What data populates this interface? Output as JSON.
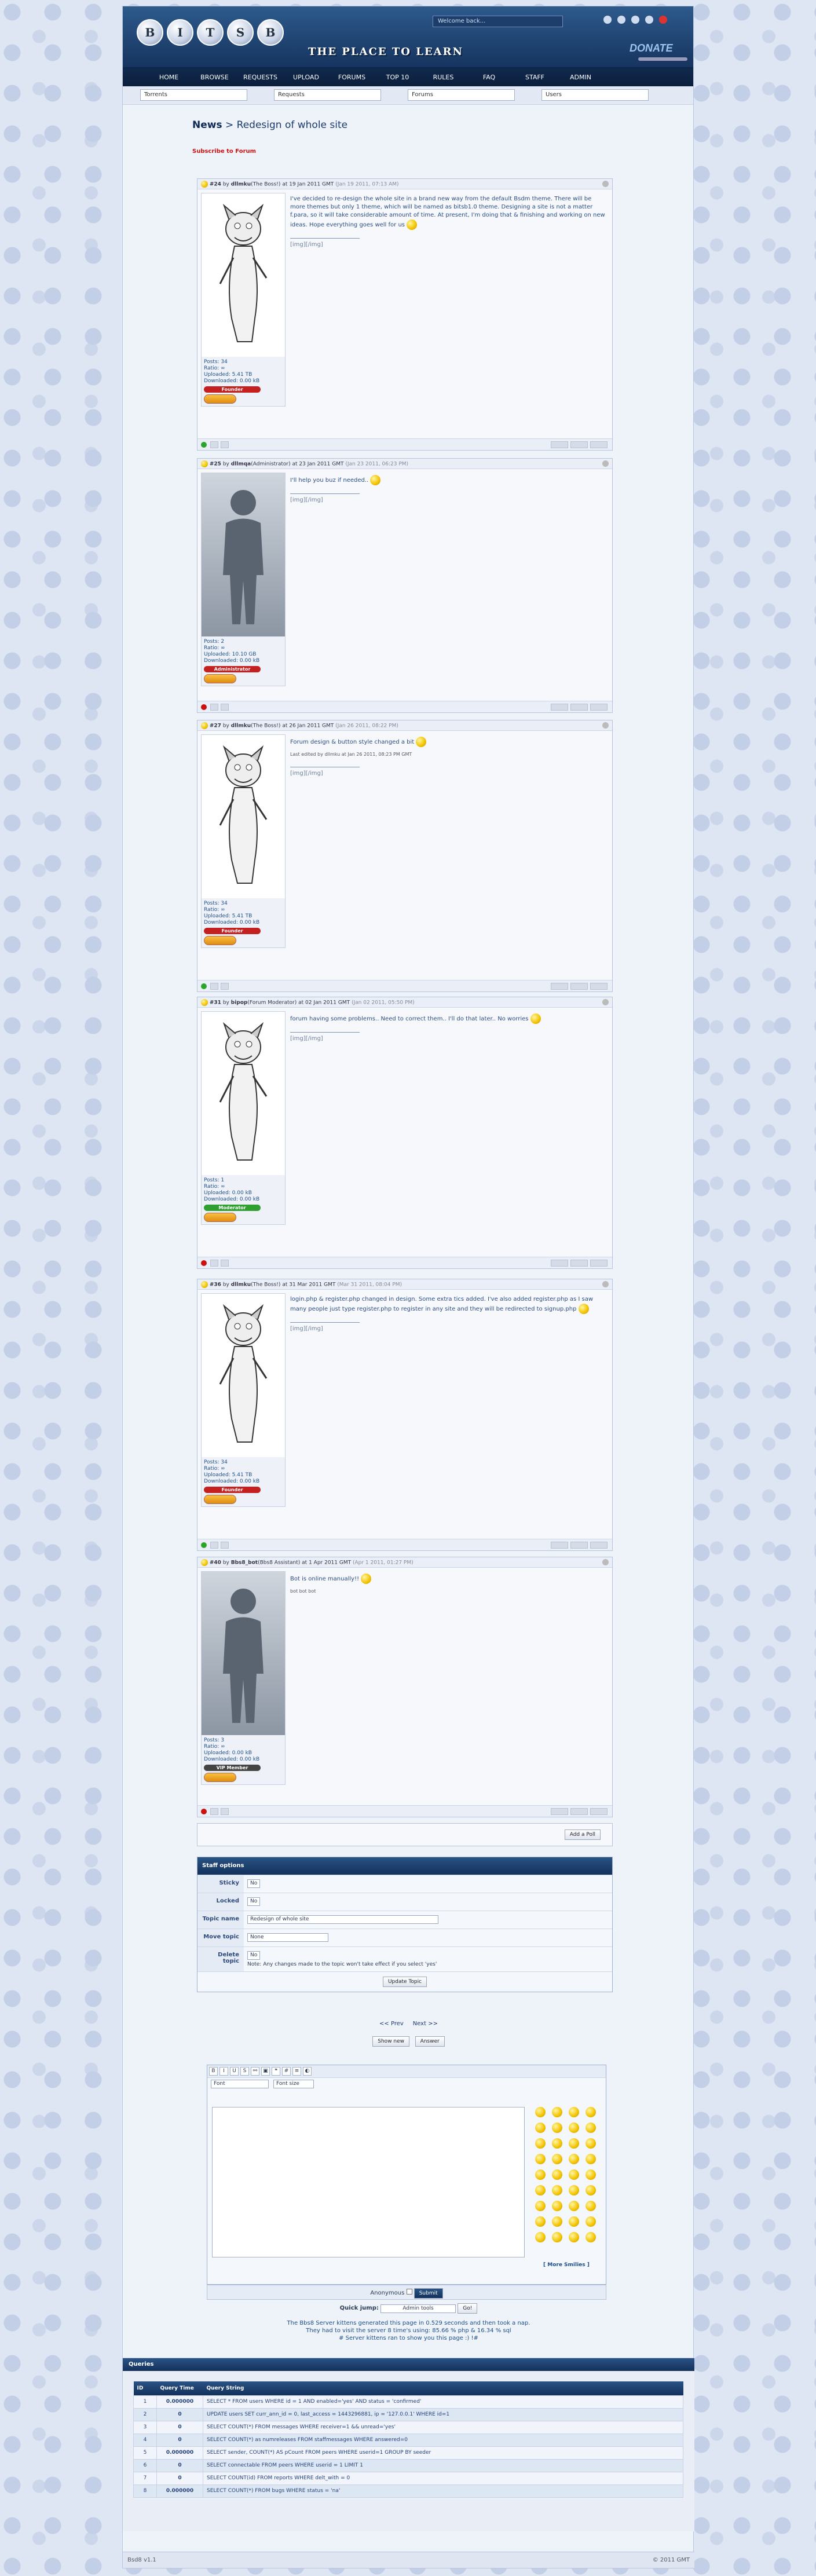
{
  "header": {
    "logo_letters": [
      "B",
      "I",
      "T",
      "S",
      "B"
    ],
    "tagline": "THE PLACE TO LEARN",
    "welcome": "Welcome back...",
    "donate": "DONATE"
  },
  "nav": [
    "HOME",
    "BROWSE",
    "REQUESTS",
    "UPLOAD",
    "FORUMS",
    "TOP 10",
    "RULES",
    "FAQ",
    "STAFF",
    "ADMIN"
  ],
  "searches": [
    "Torrents",
    "Requests",
    "Forums",
    "Users"
  ],
  "page": {
    "section": "News",
    "separator": " > ",
    "topic": "Redesign of whole site",
    "subscribe": "Subscribe to Forum"
  },
  "posts": [
    {
      "id": "#24",
      "by": "by",
      "user": "dllmku",
      "role": "(The Boss!)",
      "at": "at 19 Jan 2011 GMT",
      "ago": "(Jan 19 2011, 07:13 AM)",
      "body": "I've decided to re-design the whole site in a brand new way from the default Bsdm theme. There will be more themes but only 1 theme, which will be named as bitsb1.0 theme. Designing a site is not a matter f.para, so it will take considerable amount of time. At present, I'm doing that & finishing and working on new ideas. Hope everything goes well for us",
      "edited": "",
      "sig": "[img][/img]",
      "stats": {
        "posts": "Posts: 34",
        "ratio": "Ratio: ∞",
        "up": "Uploaded: 5.41 TB",
        "down": "Downloaded: 0.00 kB"
      },
      "badge": "Founder",
      "badge_color": "#c42020",
      "sil": false,
      "online": "#2aa52a"
    },
    {
      "id": "#25",
      "by": "by",
      "user": "dllmqa",
      "role": "(Administrator)",
      "at": "at 23 Jan 2011 GMT",
      "ago": "(Jan 23 2011, 06:23 PM)",
      "body": "I'll help you buz if needed..",
      "edited": "",
      "sig": "[img][/img]",
      "stats": {
        "posts": "Posts: 2",
        "ratio": "Ratio: ∞",
        "up": "Uploaded: 10.10 GB",
        "down": "Downloaded: 0.00 kB"
      },
      "badge": "Administrator",
      "badge_color": "#c42020",
      "sil": true,
      "online": "#cc1111"
    },
    {
      "id": "#27",
      "by": "by",
      "user": "dllmku",
      "role": "(The Boss!)",
      "at": "at 26 Jan 2011 GMT",
      "ago": "(Jan 26 2011, 08:22 PM)",
      "body": "Forum design & button style changed a bit",
      "edited": "Last edited by dllmku at Jan 26 2011, 08:23 PM GMT",
      "sig": "[img][/img]",
      "stats": {
        "posts": "Posts: 34",
        "ratio": "Ratio: ∞",
        "up": "Uploaded: 5.41 TB",
        "down": "Downloaded: 0.00 kB"
      },
      "badge": "Founder",
      "badge_color": "#c42020",
      "sil": false,
      "online": "#2aa52a"
    },
    {
      "id": "#31",
      "by": "by",
      "user": "bipop",
      "role": "(Forum Moderator)",
      "at": "at 02 Jan 2011 GMT",
      "ago": "(Jan 02 2011, 05:50 PM)",
      "body": "forum having some problems.. Need to correct them.. I'll do that later.. No worries",
      "edited": "",
      "sig": "[img][/img]",
      "stats": {
        "posts": "Posts: 1",
        "ratio": "Ratio: ∞",
        "up": "Uploaded: 0.00 kB",
        "down": "Downloaded: 0.00 kB"
      },
      "badge": "Moderator",
      "badge_color": "#2f9f2f",
      "sil": false,
      "online": "#cc1111"
    },
    {
      "id": "#36",
      "by": "by",
      "user": "dllmku",
      "role": "(The Boss!)",
      "at": "at 31 Mar 2011 GMT",
      "ago": "(Mar 31 2011, 08:04 PM)",
      "body": "login.php & register.php changed in design. Some extra tics added. I've also added register.php as I saw many people just type register.php to register in any site and they will be redirected to signup.php",
      "edited": "",
      "sig": "[img][/img]",
      "stats": {
        "posts": "Posts: 34",
        "ratio": "Ratio: ∞",
        "up": "Uploaded: 5.41 TB",
        "down": "Downloaded: 0.00 kB"
      },
      "badge": "Founder",
      "badge_color": "#c42020",
      "sil": false,
      "online": "#2aa52a"
    },
    {
      "id": "#40",
      "by": "by",
      "user": "Bbs8_bot",
      "role": "(Bbs8 Assistant)",
      "at": "at 1 Apr 2011 GMT",
      "ago": "(Apr 1 2011, 01:27 PM)",
      "body": "Bot is online manually!!",
      "edited": "bot bot bot",
      "sig": "",
      "stats": {
        "posts": "Posts: 3",
        "ratio": "Ratio: ∞",
        "up": "Uploaded: 0.00 kB",
        "down": "Downloaded: 0.00 kB"
      },
      "badge": "VIP Member",
      "badge_color": "#444444",
      "sil": true,
      "online": "#cc1111"
    }
  ],
  "add_poll": "Add a Poll",
  "staff": {
    "title": "Staff options",
    "sticky_label": "Sticky",
    "sticky": "No",
    "locked_label": "Locked",
    "locked": "No",
    "topic_label": "Topic name",
    "topic_value": "Redesign of whole site",
    "move_label": "Move topic",
    "move": "None",
    "delete_label": "Delete topic",
    "delete": "No",
    "note": "Note: Any changes made to the topic won't take effect if you select 'yes'",
    "update": "Update Topic"
  },
  "pager": {
    "prev": "<< Prev",
    "next": "Next >>",
    "show_new": "Show new",
    "answer": "Answer"
  },
  "editor": {
    "font": "Font",
    "size": "Font size",
    "more_smilies": "[ More Smilies ]",
    "anonymous": "Anonymous",
    "submit": "Submit"
  },
  "quick": {
    "label": "Quick jump:",
    "value": "Admin tools",
    "go": "Go!"
  },
  "info": [
    "The Bbs8 Server kittens generated this page in 0.529 seconds and then took a nap.",
    "They had to visit the server 8 time's using: 85.66 % php & 16.34 % sql",
    "# Server kittens ran to show you this page :) !#"
  ],
  "queries": {
    "title": "Queries",
    "headers": [
      "ID",
      "Query Time",
      "Query String"
    ],
    "rows": [
      [
        "1",
        "0.000000",
        "SELECT * FROM users WHERE id = 1 AND enabled='yes' AND status = 'confirmed'"
      ],
      [
        "2",
        "0",
        "UPDATE users SET curr_ann_id = 0, last_access = 1443296881, ip = '127.0.0.1' WHERE id=1"
      ],
      [
        "3",
        "0",
        "SELECT COUNT(*) FROM messages WHERE receiver=1 && unread='yes'"
      ],
      [
        "4",
        "0",
        "SELECT COUNT(*) as numreleases FROM staffmessages WHERE answered=0"
      ],
      [
        "5",
        "0.000000",
        "SELECT sender, COUNT(*) AS pCount FROM peers WHERE userid=1 GROUP BY seeder"
      ],
      [
        "6",
        "0",
        "SELECT connectable FROM peers WHERE userid = 1 LIMIT 1"
      ],
      [
        "7",
        "0",
        "SELECT COUNT(id) FROM reports WHERE delt_with = 0"
      ],
      [
        "8",
        "0.000000",
        "SELECT COUNT(*) FROM bugs WHERE status = 'na'"
      ]
    ]
  },
  "footer": {
    "left": "Bsd8 v1.1",
    "right": "© 2011 GMT"
  }
}
